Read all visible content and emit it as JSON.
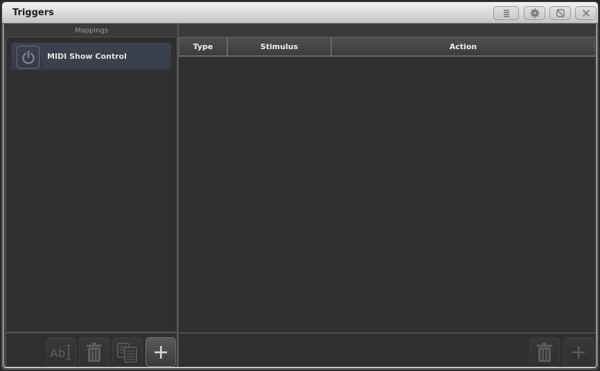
{
  "window": {
    "title": "Triggers",
    "titlebar_buttons": [
      {
        "name": "menu",
        "icon": "menu-lines-icon"
      },
      {
        "name": "settings",
        "icon": "gear-icon"
      },
      {
        "name": "maximize",
        "icon": "resize-icon"
      },
      {
        "name": "close",
        "icon": "close-icon"
      }
    ]
  },
  "mappings": {
    "label": "Mappings",
    "items": [
      {
        "label": "MIDI Show Control",
        "icon": "power-icon",
        "selected": true
      }
    ],
    "footer_buttons": [
      {
        "name": "rename",
        "icon": "rename-icon",
        "enabled": false
      },
      {
        "name": "delete",
        "icon": "trash-icon",
        "enabled": false
      },
      {
        "name": "copy",
        "icon": "copy-icon",
        "enabled": false
      },
      {
        "name": "add",
        "icon": "plus-icon",
        "enabled": true
      }
    ]
  },
  "triggers_table": {
    "columns": [
      "Type",
      "Stimulus",
      "Action"
    ],
    "rows": [],
    "footer_buttons": [
      {
        "name": "delete",
        "icon": "trash-icon",
        "enabled": false
      },
      {
        "name": "add",
        "icon": "plus-icon",
        "enabled": false
      }
    ]
  }
}
